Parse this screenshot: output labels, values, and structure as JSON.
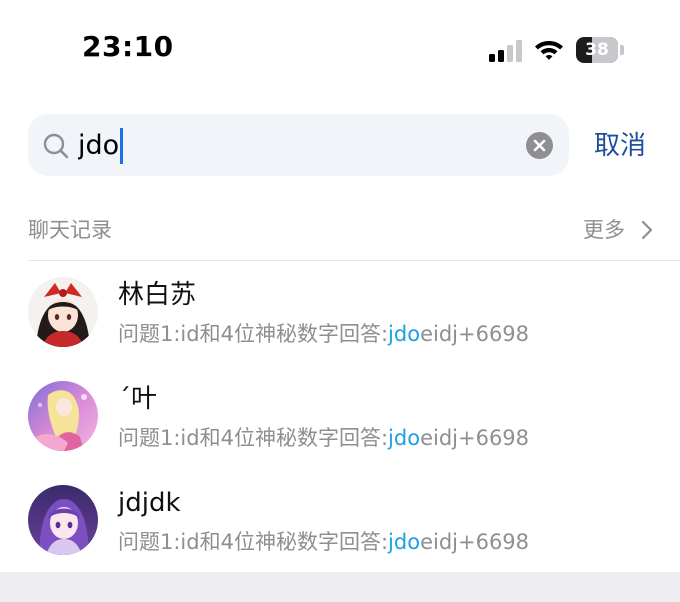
{
  "status_bar": {
    "time": "23:10",
    "battery_percent": "38",
    "battery_level": 0.38,
    "icons": [
      "cellular-signal-icon",
      "wifi-icon",
      "battery-icon"
    ]
  },
  "search": {
    "query": "jdo",
    "placeholder": "",
    "cancel_label": "取消",
    "icons": [
      "search-icon",
      "clear-icon"
    ]
  },
  "section": {
    "title": "聊天记录",
    "more_label": "更多"
  },
  "results": [
    {
      "name": "林白苏",
      "snippet_before": "问题1:id和4位神秘数字回答:",
      "snippet_match": "jdo",
      "snippet_after": "eidj+6698"
    },
    {
      "name": "´叶",
      "snippet_before": "问题1:id和4位神秘数字回答:",
      "snippet_match": "jdo",
      "snippet_after": "eidj+6698"
    },
    {
      "name": "jdjdk",
      "snippet_before": "问题1:id和4位神秘数字回答:",
      "snippet_match": "jdo",
      "snippet_after": "eidj+6698"
    }
  ],
  "colors": {
    "accent": "#1d4f9e",
    "highlight": "#1da1e2",
    "secondary_text": "#8e8e93",
    "search_bg": "#f1f4f9"
  }
}
